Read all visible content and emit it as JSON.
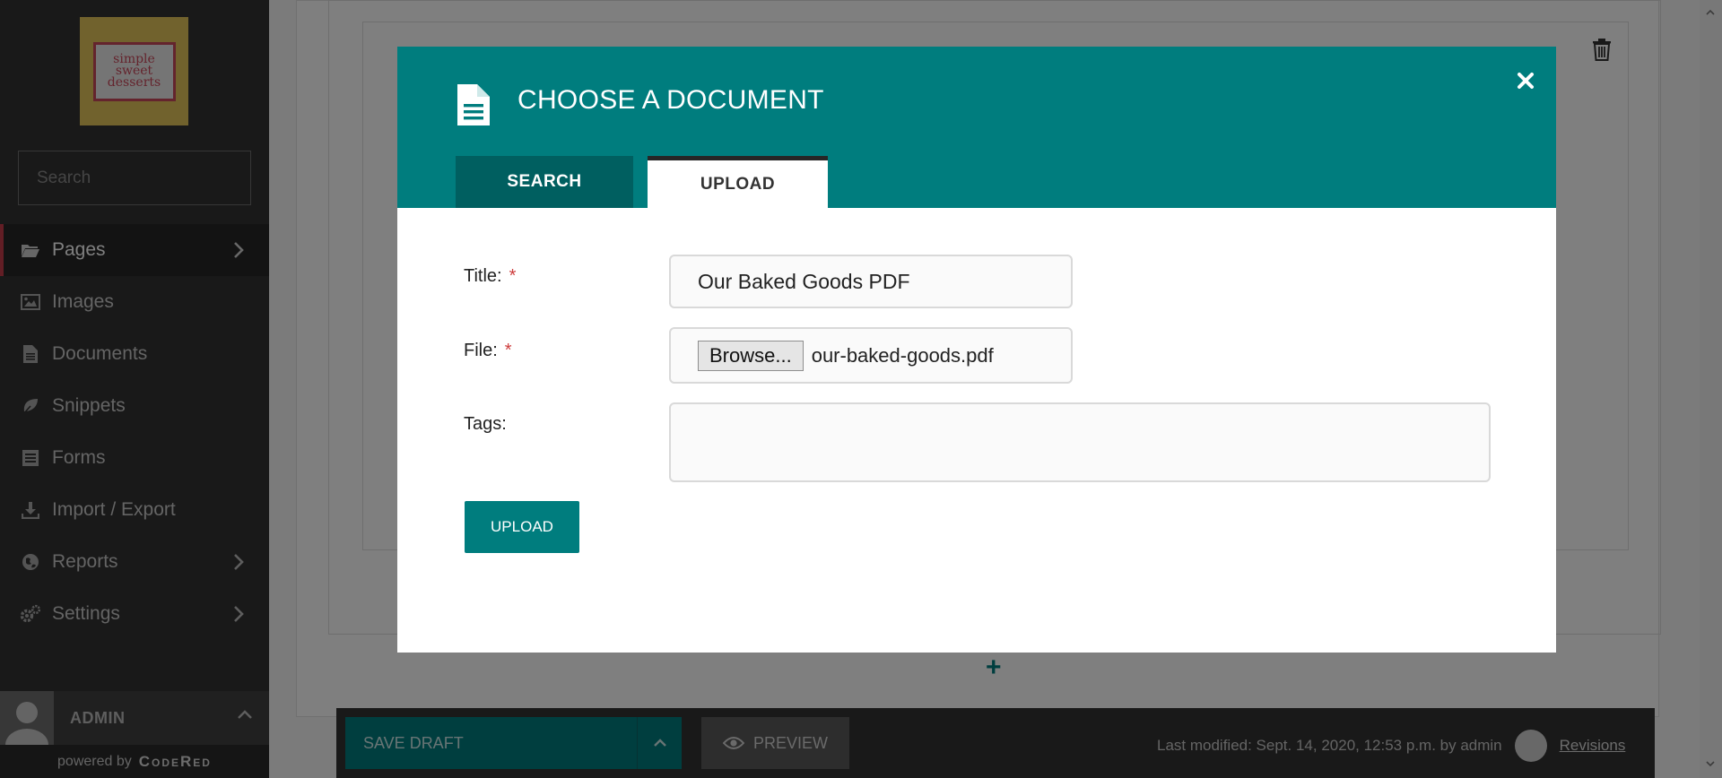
{
  "sidebar": {
    "logo_text": "simple\nsweet\ndesserts",
    "search_placeholder": "Search",
    "items": [
      {
        "label": "Pages",
        "icon": "folder-open-icon",
        "active": true,
        "chevron": true
      },
      {
        "label": "Images",
        "icon": "image-icon",
        "chevron": false
      },
      {
        "label": "Documents",
        "icon": "document-icon",
        "chevron": false
      },
      {
        "label": "Snippets",
        "icon": "leaf-icon",
        "chevron": false
      },
      {
        "label": "Forms",
        "icon": "list-form-icon",
        "chevron": false
      },
      {
        "label": "Import / Export",
        "icon": "download-icon",
        "chevron": false
      },
      {
        "label": "Reports",
        "icon": "globe-icon",
        "chevron": true
      },
      {
        "label": "Settings",
        "icon": "cogs-icon",
        "chevron": true
      }
    ],
    "account_name": "ADMIN",
    "powered_label": "powered by",
    "powered_brand": "CodeRed"
  },
  "modal": {
    "title": "CHOOSE A DOCUMENT",
    "tabs": [
      {
        "label": "SEARCH",
        "active": false
      },
      {
        "label": "UPLOAD",
        "active": true
      }
    ],
    "form": {
      "title_label": "Title:",
      "title_value": "Our Baked Goods PDF",
      "file_label": "File:",
      "browse_label": "Browse...",
      "file_name": "our-baked-goods.pdf",
      "tags_label": "Tags:",
      "tags_value": "",
      "required_mark": "*"
    },
    "submit_label": "UPLOAD"
  },
  "footer": {
    "save_draft_label": "SAVE DRAFT",
    "preview_label": "PREVIEW",
    "last_modified": "Last modified: Sept. 14, 2020, 12:53 p.m. by admin",
    "revisions_label": "Revisions"
  },
  "colors": {
    "accent": "#007d7e",
    "sidebar_bg": "#333333",
    "active_marker": "#c43d4a",
    "required": "#cd3c3c"
  }
}
